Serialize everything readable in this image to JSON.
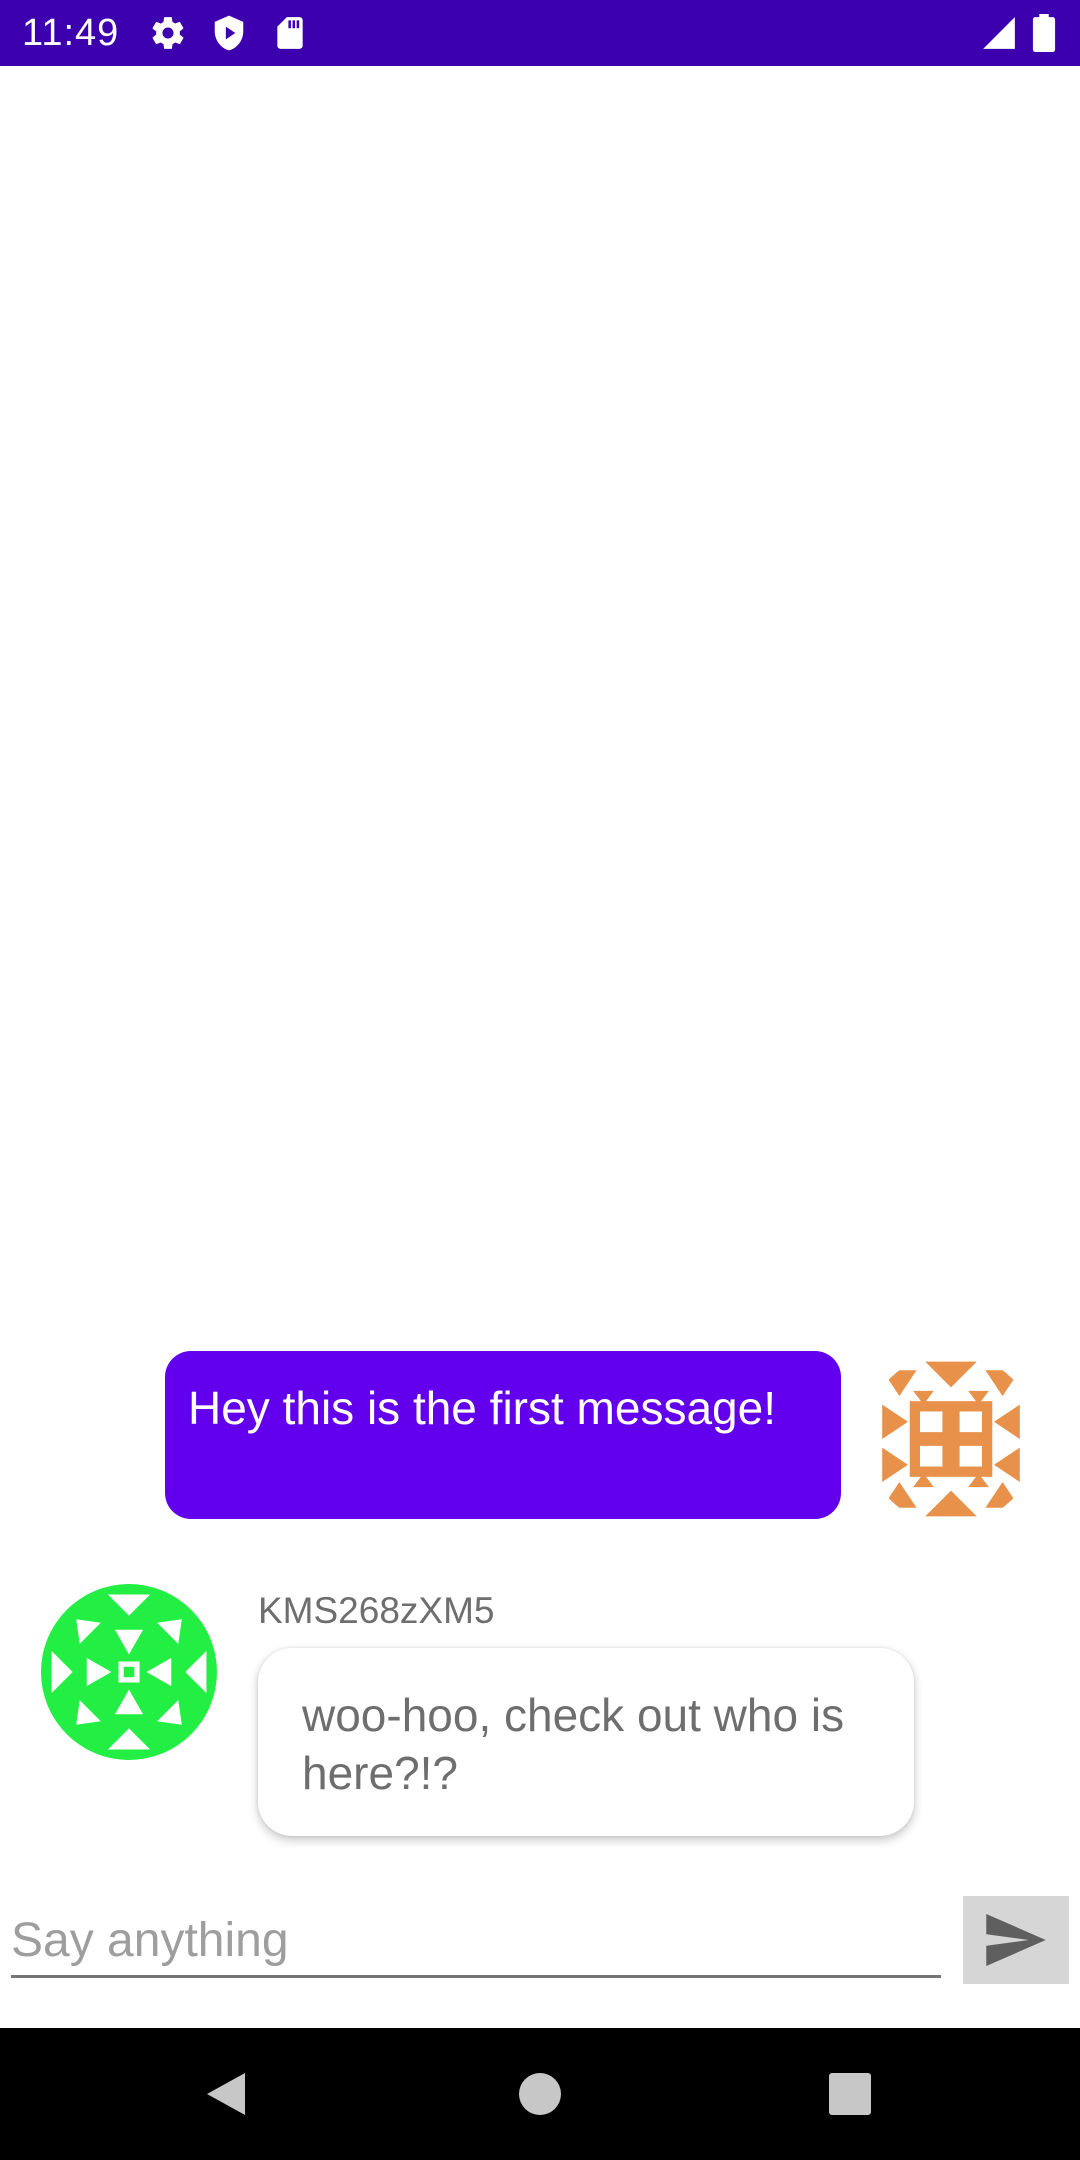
{
  "status_bar": {
    "time": "11:49",
    "icons": [
      "gear-icon",
      "shield-play-icon",
      "sd-card-icon",
      "signal-icon",
      "battery-icon"
    ],
    "background": "#3d00ae"
  },
  "messages": [
    {
      "direction": "outgoing",
      "text": "Hey this is the first message!",
      "bubble_color": "#6200ee",
      "avatar": "identicon-orange",
      "avatar_color": "#e8914a"
    },
    {
      "direction": "incoming",
      "sender": "KMS268zXM5",
      "text": "woo-hoo, check out who is here?!?",
      "bubble_color": "#ffffff",
      "avatar": "identicon-green",
      "avatar_color": "#22ee44"
    }
  ],
  "composer": {
    "placeholder": "Say anything",
    "value": "",
    "send_icon": "send-icon"
  },
  "nav_bar": {
    "buttons": [
      "back-icon",
      "home-icon",
      "recents-icon"
    ]
  }
}
